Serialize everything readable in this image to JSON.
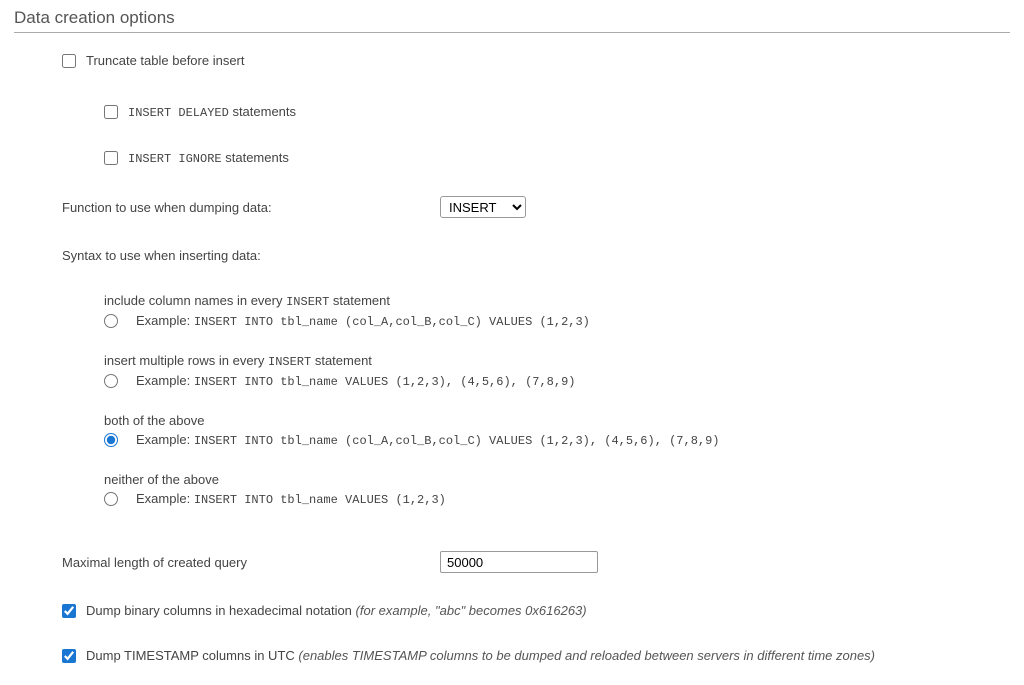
{
  "title": "Data creation options",
  "truncate_label": "Truncate table before insert",
  "insert_delayed_prefix": "INSERT DELAYED",
  "insert_ignore_prefix": "INSERT IGNORE",
  "statements_suffix": " statements",
  "function_label": "Function to use when dumping data:",
  "function_selected": "INSERT",
  "syntax_label": "Syntax to use when inserting data:",
  "radio": {
    "opt1_label_prefix": "include column names in every ",
    "opt1_label_keyword": "INSERT",
    "opt1_label_suffix": " statement",
    "opt1_example_prefix": "Example: ",
    "opt1_example_code": "INSERT INTO tbl_name (col_A,col_B,col_C) VALUES (1,2,3)",
    "opt2_label_prefix": "insert multiple rows in every ",
    "opt2_label_keyword": "INSERT",
    "opt2_label_suffix": " statement",
    "opt2_example_prefix": "Example: ",
    "opt2_example_code": "INSERT INTO tbl_name VALUES (1,2,3), (4,5,6), (7,8,9)",
    "opt3_label": "both of the above",
    "opt3_example_prefix": "Example: ",
    "opt3_example_code": "INSERT INTO tbl_name (col_A,col_B,col_C) VALUES (1,2,3), (4,5,6), (7,8,9)",
    "opt4_label": "neither of the above",
    "opt4_example_prefix": "Example: ",
    "opt4_example_code": "INSERT INTO tbl_name VALUES (1,2,3)"
  },
  "max_length_label": "Maximal length of created query",
  "max_length_value": "50000",
  "hex_label": "Dump binary columns in hexadecimal notation ",
  "hex_hint": "(for example, \"abc\" becomes 0x616263)",
  "utc_label": "Dump TIMESTAMP columns in UTC ",
  "utc_hint": "(enables TIMESTAMP columns to be dumped and reloaded between servers in different time zones)"
}
